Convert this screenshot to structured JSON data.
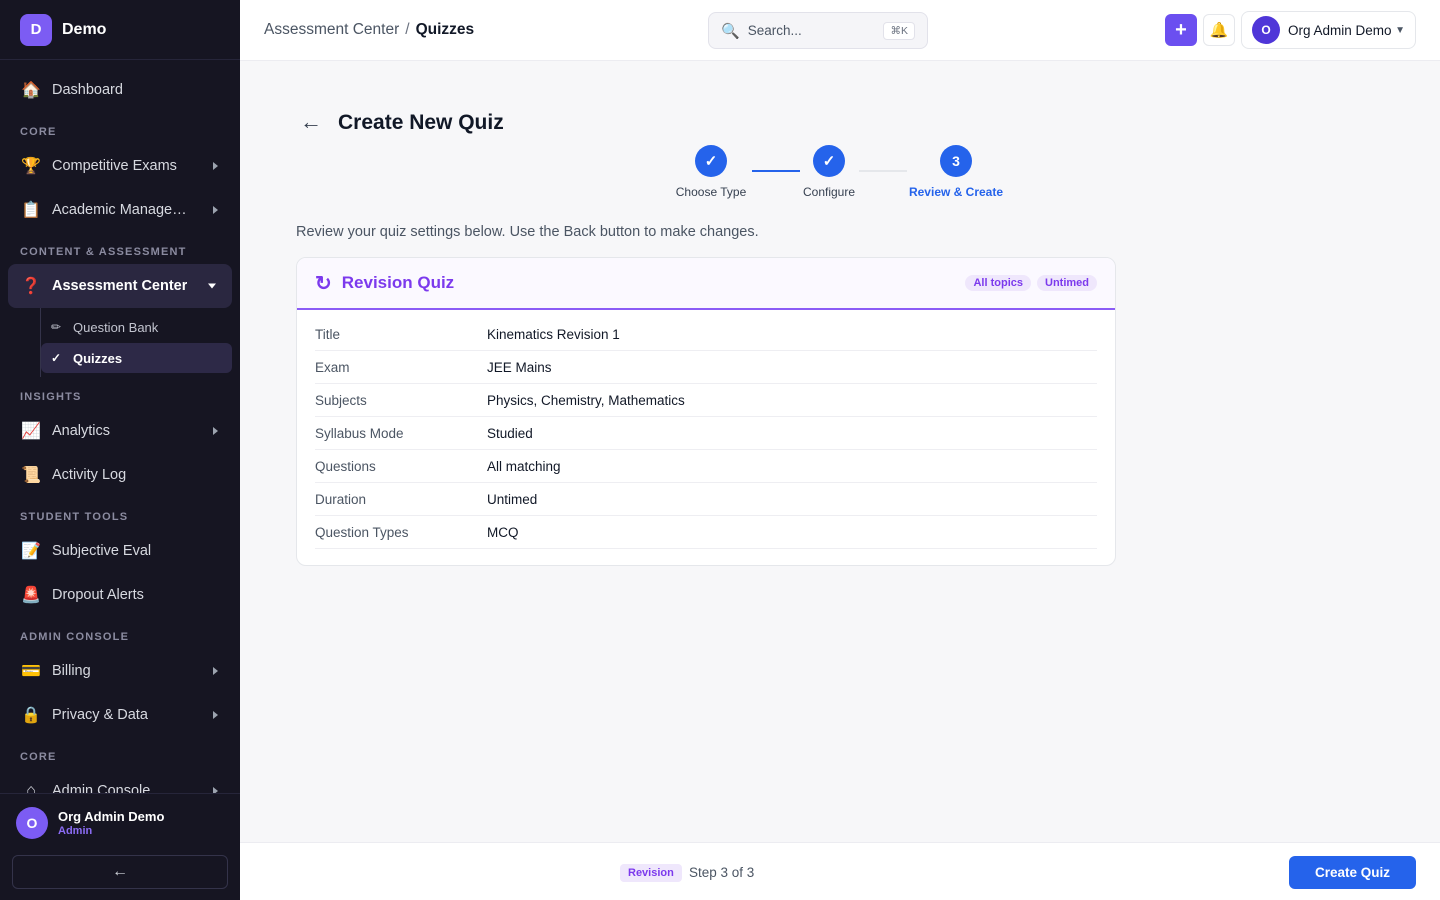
{
  "brand": {
    "logo_letter": "D",
    "name": "Demo"
  },
  "sidebar": {
    "dashboard": {
      "label": "Dashboard",
      "icon": "🏠"
    },
    "sections": {
      "core": "CORE",
      "content": "CONTENT & ASSESSMENT",
      "insights": "INSIGHTS",
      "student_tools": "STUDENT TOOLS",
      "admin_console": "ADMIN CONSOLE",
      "core2": "CORE"
    },
    "items": {
      "competitive_exams": {
        "label": "Competitive Exams",
        "icon": "🏆"
      },
      "academic": {
        "label": "Academic Management",
        "icon": "📋"
      },
      "assessment_center": {
        "label": "Assessment Center",
        "icon": "❓"
      },
      "question_bank": {
        "label": "Question Bank",
        "icon": "✏"
      },
      "quizzes": {
        "label": "Quizzes",
        "icon": "✓"
      },
      "analytics": {
        "label": "Analytics",
        "icon": "📈"
      },
      "activity_log": {
        "label": "Activity Log",
        "icon": "📜"
      },
      "subjective_eval": {
        "label": "Subjective Eval",
        "icon": "📝"
      },
      "dropout_alerts": {
        "label": "Dropout Alerts",
        "icon": "🚨"
      },
      "billing": {
        "label": "Billing",
        "icon": "💳"
      },
      "privacy": {
        "label": "Privacy & Data",
        "icon": "🔒"
      },
      "admin_console": {
        "label": "Admin Console",
        "icon": "⌂"
      }
    },
    "user": {
      "initial": "O",
      "name": "Org Admin Demo",
      "role": "Admin"
    },
    "collapse_icon": "←"
  },
  "topbar": {
    "breadcrumb_parent": "Assessment Center",
    "breadcrumb_sep": "/",
    "breadcrumb_current": "Quizzes",
    "search_icon": "🔍",
    "search_placeholder": "Search...",
    "search_shortcut": "⌘K",
    "plus": "+",
    "bell": "🔔",
    "profile_initial": "O",
    "profile_name": "Org Admin Demo",
    "profile_caret": "▼"
  },
  "page": {
    "back_icon": "←",
    "title": "Create New Quiz",
    "intro": "Review your quiz settings below. Use the Back button to make changes."
  },
  "stepper": {
    "steps": [
      {
        "label": "Choose Type",
        "mark": "✓"
      },
      {
        "label": "Configure",
        "mark": "✓"
      },
      {
        "label": "Review & Create",
        "mark": "3"
      }
    ]
  },
  "card": {
    "icon": "↻",
    "title": "Revision Quiz",
    "tags": [
      "All topics",
      "Untimed"
    ],
    "rows": [
      {
        "key": "Title",
        "value": "Kinematics Revision 1"
      },
      {
        "key": "Exam",
        "value": "JEE Mains"
      },
      {
        "key": "Subjects",
        "value": "Physics, Chemistry, Mathematics"
      },
      {
        "key": "Syllabus Mode",
        "value": "Studied"
      },
      {
        "key": "Questions",
        "value": "All matching"
      },
      {
        "key": "Duration",
        "value": "Untimed"
      },
      {
        "key": "Question Types",
        "value": "MCQ"
      }
    ]
  },
  "footer": {
    "tag": "Revision",
    "step_text": "Step 3 of 3",
    "create_label": "Create Quiz"
  },
  "colors": {
    "accent": "#2563eb",
    "purple": "#7c3aed",
    "sidebar_bg": "#161522"
  }
}
